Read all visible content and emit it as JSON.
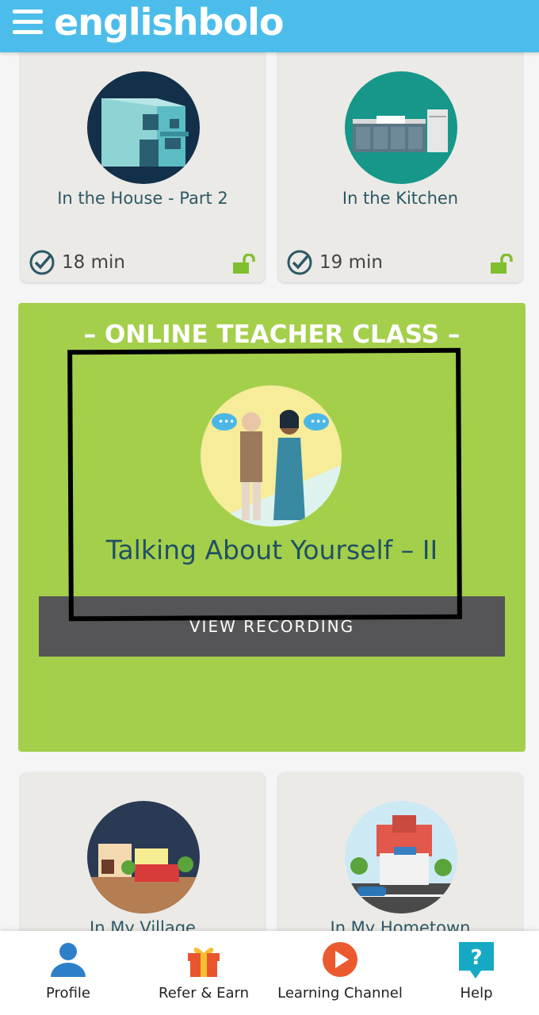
{
  "header": {
    "logo_text": "englishbolo"
  },
  "cards_top": [
    {
      "title": "In the House - Part 2",
      "duration": "18 min"
    },
    {
      "title": "In the Kitchen",
      "duration": "19 min"
    }
  ],
  "feature": {
    "label": "–  ONLINE TEACHER CLASS  –",
    "title": "Talking About Yourself – II",
    "button": "VIEW RECORDING"
  },
  "cards_bottom": [
    {
      "title": "In My Village"
    },
    {
      "title": "In My Hometown"
    }
  ],
  "bottom_nav": [
    {
      "label": "Profile"
    },
    {
      "label": "Refer & Earn"
    },
    {
      "label": "Learning Channel"
    },
    {
      "label": "Help"
    }
  ],
  "colors": {
    "header": "#4cbdea",
    "feature": "#a4cf4b",
    "button": "#555456",
    "lock": "#7fbf2e"
  }
}
